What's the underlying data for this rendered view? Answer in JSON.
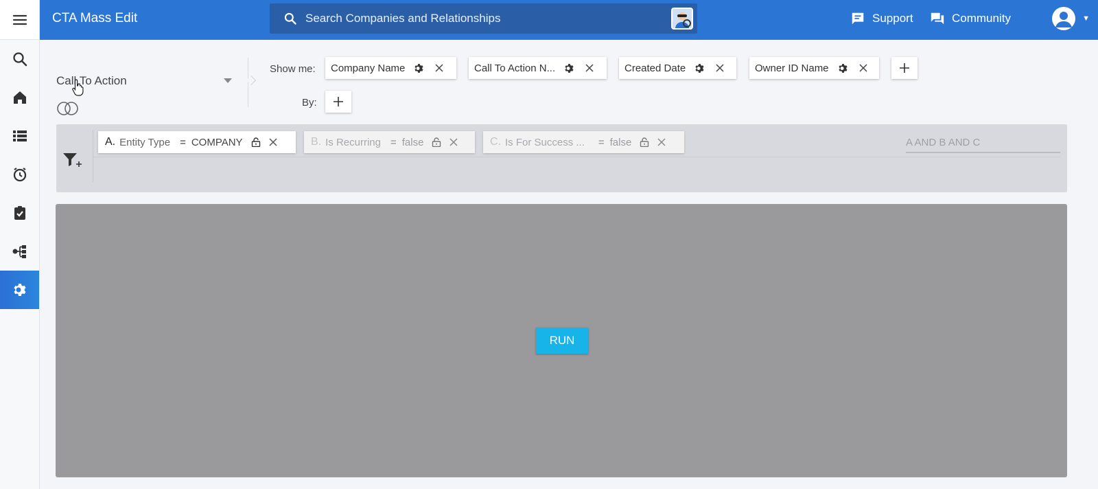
{
  "app": {
    "title": "CTA Mass Edit"
  },
  "search": {
    "placeholder": "Search Companies and Relationships"
  },
  "topnav": {
    "support_label": "Support",
    "community_label": "Community"
  },
  "sidebar": {
    "items": [
      {
        "name": "menu",
        "icon": "hamburger-icon"
      },
      {
        "name": "search",
        "icon": "search-icon"
      },
      {
        "name": "home",
        "icon": "home-icon"
      },
      {
        "name": "list",
        "icon": "list-icon"
      },
      {
        "name": "timeline",
        "icon": "alarm-clock-icon"
      },
      {
        "name": "tasks",
        "icon": "clipboard-check-icon"
      },
      {
        "name": "hierarchy",
        "icon": "hierarchy-icon"
      },
      {
        "name": "settings",
        "icon": "gear-icon",
        "active": true
      }
    ]
  },
  "builder": {
    "object_label": "Call To Action",
    "show_me_label": "Show me:",
    "by_label": "By:",
    "fields": [
      {
        "label": "Company Name"
      },
      {
        "label": "Call To Action N..."
      },
      {
        "label": "Created Date"
      },
      {
        "label": "Owner ID Name"
      }
    ]
  },
  "filters": {
    "items": [
      {
        "letter": "A.",
        "field": "Entity Type",
        "operator": "=",
        "value": "COMPANY",
        "enabled": true
      },
      {
        "letter": "B.",
        "field": "Is Recurring",
        "operator": "=",
        "value": "false",
        "enabled": false
      },
      {
        "letter": "C.",
        "field": "Is For Success ...",
        "operator": "=",
        "value": "false",
        "enabled": false
      }
    ],
    "logic_placeholder": "A AND B AND C"
  },
  "results": {
    "run_label": "RUN"
  },
  "colors": {
    "header": "#2b75d4",
    "search_bg": "#2a5fa8",
    "active_rail": "#2a86dd",
    "run_button": "#16b4e8",
    "results_overlay": "#9a9a9c"
  }
}
